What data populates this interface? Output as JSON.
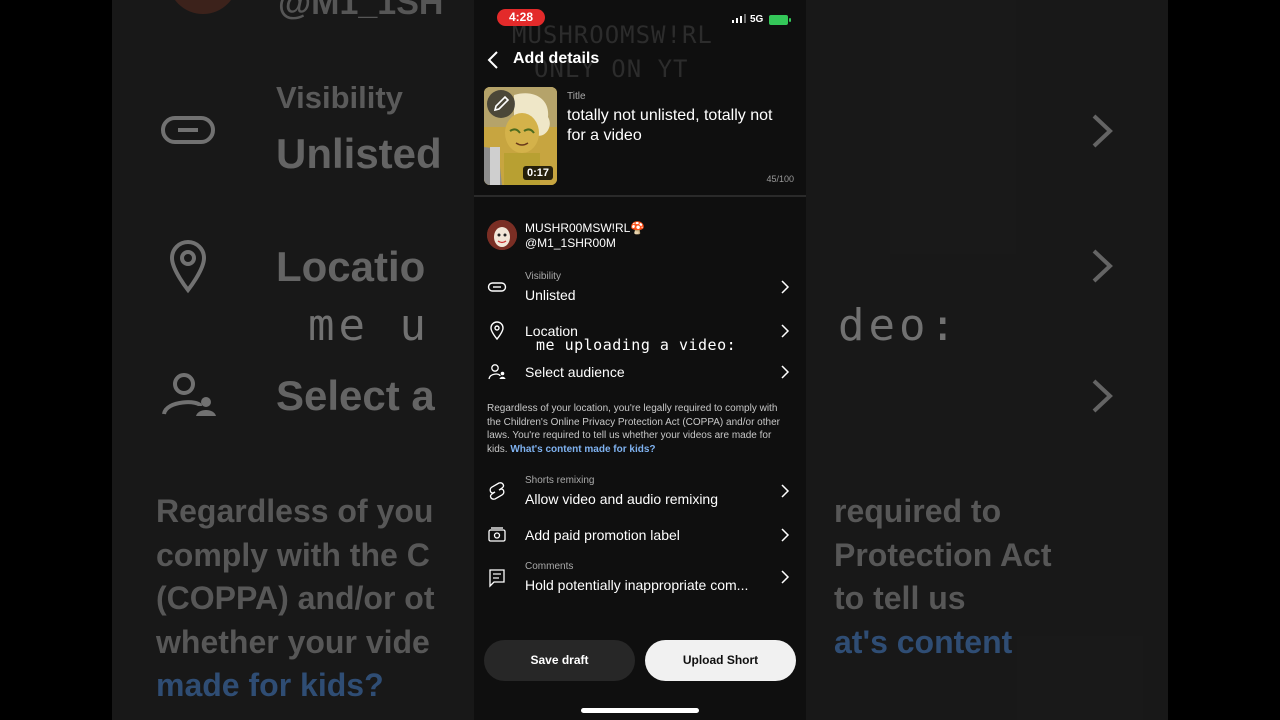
{
  "status_bar": {
    "time": "4:28",
    "network": "5G"
  },
  "watermark": {
    "line1": "MUSHROOMSW!RL",
    "line2": "ONLY ON YT"
  },
  "header": {
    "title": "Add details"
  },
  "video": {
    "duration": "0:17",
    "title_label": "Title",
    "title": "totally not unlisted, totally not for a video",
    "char_count": "45/100"
  },
  "channel": {
    "name": "MUSHR00MSW!RL🍄",
    "handle": "@M1_1SHR00M"
  },
  "settings": {
    "visibility": {
      "label": "Visibility",
      "value": "Unlisted",
      "icon": "link-icon"
    },
    "location": {
      "value": "Location",
      "icon": "location-pin-icon"
    },
    "audience": {
      "value": "Select audience",
      "icon": "audience-icon"
    },
    "remixing": {
      "label": "Shorts remixing",
      "value": "Allow video and audio remixing",
      "icon": "shorts-icon"
    },
    "paid_promotion": {
      "value": "Add paid promotion label",
      "icon": "paid-promotion-icon"
    },
    "comments": {
      "label": "Comments",
      "value": "Hold potentially inappropriate com...",
      "icon": "comment-icon"
    }
  },
  "overlay_caption": "me uploading a video:",
  "legal": {
    "text": "Regardless of your location, you're legally required to comply with the Children's Online Privacy Protection Act (COPPA) and/or other laws. You're required to tell us whether your videos are made for kids.",
    "link": "What's content made for kids?"
  },
  "actions": {
    "save_draft": "Save draft",
    "upload": "Upload Short"
  },
  "background": {
    "top_name": "@M1_1SH",
    "visibility_label": "Visibility",
    "visibility_value": "Unlisted",
    "location_value": "Locatio",
    "audience_value": "Select a",
    "caption_left": "me u",
    "caption_right": "deo:",
    "para_left": [
      "Regardless of you",
      "comply with the C",
      "(COPPA) and/or ot",
      "whether your vide"
    ],
    "para_left_link": "made for kids?",
    "para_right": [
      "required to",
      "Protection Act",
      "to tell us"
    ],
    "para_right_link": "at's content"
  },
  "colors": {
    "accent_link": "#7fb2f0",
    "time_pill": "#e32a2a",
    "battery": "#34c759",
    "panel_bg": "#0f0f0f"
  }
}
